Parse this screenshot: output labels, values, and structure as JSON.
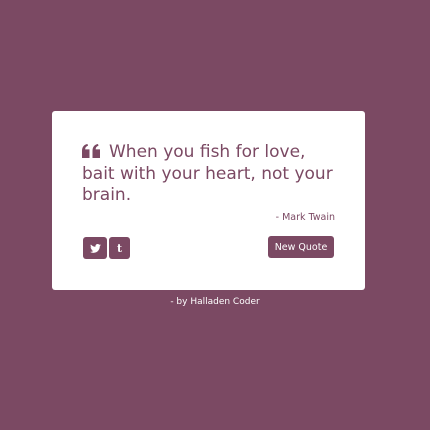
{
  "colors": {
    "background": "#7b4963",
    "card": "#ffffff",
    "accent": "#7b4963"
  },
  "quote": {
    "icon": "quote-left-icon",
    "text": "When you fish for love, bait with your heart, not your brain.",
    "author": "- Mark Twain"
  },
  "actions": {
    "tweet_icon": "twitter-icon",
    "tumblr_label": "t",
    "new_quote_label": "New Quote"
  },
  "footer": {
    "credit": "- by Halladen Coder"
  }
}
